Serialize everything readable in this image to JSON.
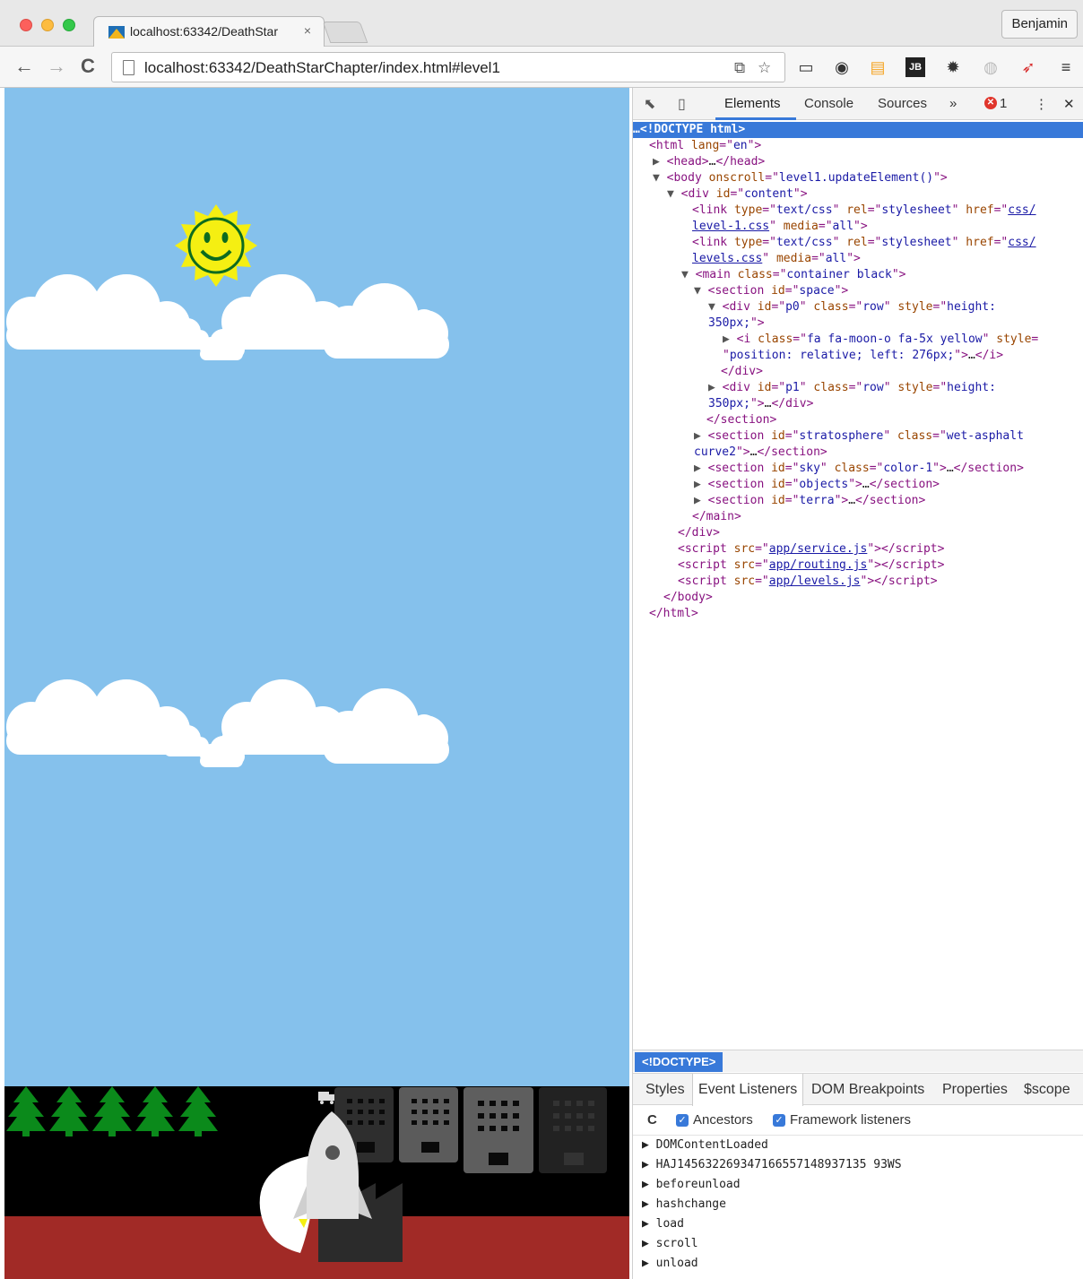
{
  "browser": {
    "tab_title": "localhost:63342/DeathStar",
    "tab_close": "×",
    "profile_name": "Benjamin",
    "url": "localhost:63342/DeathStarChapter/index.html#level1",
    "back_glyph": "←",
    "forward_glyph": "→",
    "reload_glyph": "C",
    "menu_glyph": "≡"
  },
  "devtools": {
    "tabs": [
      "Elements",
      "Console",
      "Sources"
    ],
    "more_glyph": "»",
    "error_count": "1",
    "close_glyph": "✕",
    "kebab_glyph": "⋮",
    "breadcrumb": "<!DOCTYPE>",
    "sub_tabs": [
      "Styles",
      "Event Listeners",
      "DOM Breakpoints",
      "Properties",
      "$scope"
    ],
    "refresh_glyph": "C",
    "ancestors_label": "Ancestors",
    "framework_label": "Framework listeners",
    "events": [
      "DOMContentLoaded",
      "HAJ145632269347166557148937135 93WS",
      "beforeunload",
      "hashchange",
      "load",
      "scroll",
      "unload"
    ]
  },
  "colors": {
    "sky": "#85c1ec",
    "ground": "#000000",
    "terra": "#a12a26",
    "tree": "#0b8a1b",
    "sun": "#f5ef12",
    "accent": "#3879d9"
  }
}
